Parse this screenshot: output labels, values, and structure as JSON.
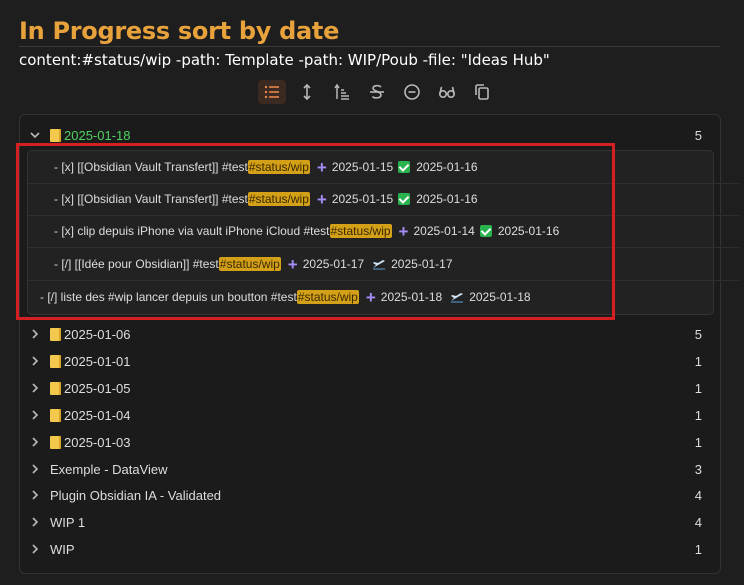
{
  "page": {
    "title": "In Progress sort by date",
    "query": "content:#status/wip -path: Template -path: WIP/Poub -file: \"Ideas Hub\""
  },
  "toolbar": {
    "buttons": [
      {
        "icon": "list-icon",
        "active": true
      },
      {
        "icon": "expand-vertical-icon"
      },
      {
        "icon": "sort-icon"
      },
      {
        "icon": "strikethrough-icon"
      },
      {
        "icon": "minus-circle-icon"
      },
      {
        "icon": "glasses-icon"
      },
      {
        "icon": "copy-icon"
      }
    ]
  },
  "groups": [
    {
      "label": "2025-01-18",
      "count": "5",
      "expanded": true,
      "note_icon": true
    },
    {
      "label": "2025-01-06",
      "count": "5",
      "note_icon": true
    },
    {
      "label": "2025-01-01",
      "count": "1",
      "note_icon": true
    },
    {
      "label": "2025-01-05",
      "count": "1",
      "note_icon": true
    },
    {
      "label": "2025-01-04",
      "count": "1",
      "note_icon": true
    },
    {
      "label": "2025-01-03",
      "count": "1",
      "note_icon": true
    },
    {
      "label": "Exemple - DataView",
      "count": "3"
    },
    {
      "label": "Plugin Obsidian IA - Validated",
      "count": "4"
    },
    {
      "label": "WIP 1",
      "count": "4"
    },
    {
      "label": "WIP",
      "count": "1"
    }
  ],
  "tasks": [
    {
      "text": "- [x] [[Obsidian Vault Transfert]] #test ",
      "tag": "#status/wip",
      "created": "2025-01-15",
      "done": "2025-01-16",
      "end_icon": "check"
    },
    {
      "text": "- [x] [[Obsidian Vault Transfert]] #test ",
      "tag": "#status/wip",
      "created": "2025-01-15",
      "done": "2025-01-16",
      "end_icon": "check"
    },
    {
      "text": "- [x] clip depuis iPhone via  vault iPhone iCloud #test ",
      "tag": "#status/wip",
      "created": "2025-01-14",
      "done": "2025-01-16",
      "end_icon": "check"
    },
    {
      "text": "- [/] [[Idée pour Obsidian]]   #test ",
      "tag": "#status/wip",
      "created": "2025-01-17",
      "done": "2025-01-17",
      "end_icon": "plane"
    },
    {
      "text": "- [/] liste des #wip lancer depuis un boutton  #test ",
      "tag": "#status/wip",
      "created": "2025-01-18",
      "done": "2025-01-18",
      "end_icon": "plane"
    }
  ],
  "colors": {
    "title": "#e8a23c",
    "tag_bg": "#d4a017",
    "highlight_box": "#d42020",
    "plus": "#a58df5",
    "check": "#29b34f"
  }
}
